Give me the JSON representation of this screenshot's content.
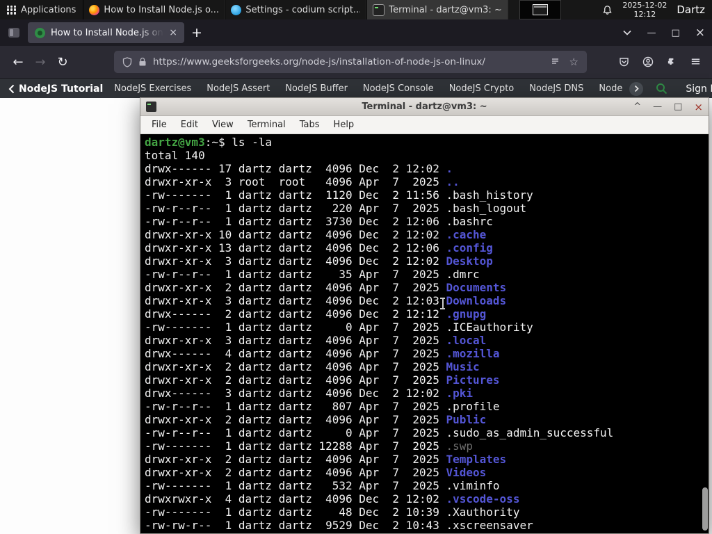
{
  "icons": {
    "back": "←",
    "forward": "→",
    "reload": "↻",
    "star": "☆",
    "close": "×",
    "minimize": "—",
    "maximize": "□",
    "new_tab": "+",
    "menu": "≡",
    "shade": "^"
  },
  "panel": {
    "applications": "Applications",
    "windows": [
      {
        "title": "How to Install Node.js o...",
        "icon": "firefox-window-icon",
        "active": false
      },
      {
        "title": "Settings - codium script...",
        "icon": "codium-window-icon",
        "active": false
      },
      {
        "title": "Terminal - dartz@vm3: ~",
        "icon": "terminal-window-icon",
        "active": true
      }
    ],
    "date": "2025-12-02",
    "time": "12:12",
    "user": "Dartz"
  },
  "browser": {
    "tab": {
      "title": "How to Install Node.js on"
    },
    "url": "https://www.geeksforgeeks.org/node-js/installation-of-node-js-on-linux/",
    "site_nav": {
      "back_label": "NodeJS Tutorial",
      "links": [
        "NodeJS Exercises",
        "NodeJS Assert",
        "NodeJS Buffer",
        "NodeJS Console",
        "NodeJS Crypto",
        "NodeJS DNS",
        "Node"
      ],
      "sign_in": "Sign In"
    }
  },
  "terminal": {
    "title": "Terminal - dartz@vm3: ~",
    "menu": [
      "File",
      "Edit",
      "View",
      "Terminal",
      "Tabs",
      "Help"
    ],
    "prompt": {
      "user_host": "dartz@vm3",
      "rest": ":~$ "
    },
    "command": "ls -la",
    "total": "total 140",
    "colors": {
      "prompt_green": "#44a544",
      "dir_blue": "#5456d6",
      "file_white": "#f2f2f2",
      "dim_gray": "#6e6e6e"
    },
    "listing": [
      {
        "perms": "drwx------",
        "links": 17,
        "owner": "dartz",
        "group": "dartz",
        "size": 4096,
        "month": "Dec",
        "day": 2,
        "time": "12:02",
        "name": ".",
        "kind": "dir"
      },
      {
        "perms": "drwxr-xr-x",
        "links": 3,
        "owner": "root",
        "group": "root",
        "size": 4096,
        "month": "Apr",
        "day": 7,
        "time": "2025",
        "name": "..",
        "kind": "dir"
      },
      {
        "perms": "-rw-------",
        "links": 1,
        "owner": "dartz",
        "group": "dartz",
        "size": 1120,
        "month": "Dec",
        "day": 2,
        "time": "11:56",
        "name": ".bash_history",
        "kind": "file"
      },
      {
        "perms": "-rw-r--r--",
        "links": 1,
        "owner": "dartz",
        "group": "dartz",
        "size": 220,
        "month": "Apr",
        "day": 7,
        "time": "2025",
        "name": ".bash_logout",
        "kind": "file"
      },
      {
        "perms": "-rw-r--r--",
        "links": 1,
        "owner": "dartz",
        "group": "dartz",
        "size": 3730,
        "month": "Dec",
        "day": 2,
        "time": "12:06",
        "name": ".bashrc",
        "kind": "file"
      },
      {
        "perms": "drwxr-xr-x",
        "links": 10,
        "owner": "dartz",
        "group": "dartz",
        "size": 4096,
        "month": "Dec",
        "day": 2,
        "time": "12:02",
        "name": ".cache",
        "kind": "dir"
      },
      {
        "perms": "drwxr-xr-x",
        "links": 13,
        "owner": "dartz",
        "group": "dartz",
        "size": 4096,
        "month": "Dec",
        "day": 2,
        "time": "12:06",
        "name": ".config",
        "kind": "dir"
      },
      {
        "perms": "drwxr-xr-x",
        "links": 3,
        "owner": "dartz",
        "group": "dartz",
        "size": 4096,
        "month": "Dec",
        "day": 2,
        "time": "12:02",
        "name": "Desktop",
        "kind": "dir"
      },
      {
        "perms": "-rw-r--r--",
        "links": 1,
        "owner": "dartz",
        "group": "dartz",
        "size": 35,
        "month": "Apr",
        "day": 7,
        "time": "2025",
        "name": ".dmrc",
        "kind": "file"
      },
      {
        "perms": "drwxr-xr-x",
        "links": 2,
        "owner": "dartz",
        "group": "dartz",
        "size": 4096,
        "month": "Apr",
        "day": 7,
        "time": "2025",
        "name": "Documents",
        "kind": "dir"
      },
      {
        "perms": "drwxr-xr-x",
        "links": 3,
        "owner": "dartz",
        "group": "dartz",
        "size": 4096,
        "month": "Dec",
        "day": 2,
        "time": "12:03",
        "name": "Downloads",
        "kind": "dir"
      },
      {
        "perms": "drwx------",
        "links": 2,
        "owner": "dartz",
        "group": "dartz",
        "size": 4096,
        "month": "Dec",
        "day": 2,
        "time": "12:12",
        "name": ".gnupg",
        "kind": "dir"
      },
      {
        "perms": "-rw-------",
        "links": 1,
        "owner": "dartz",
        "group": "dartz",
        "size": 0,
        "month": "Apr",
        "day": 7,
        "time": "2025",
        "name": ".ICEauthority",
        "kind": "file"
      },
      {
        "perms": "drwxr-xr-x",
        "links": 3,
        "owner": "dartz",
        "group": "dartz",
        "size": 4096,
        "month": "Apr",
        "day": 7,
        "time": "2025",
        "name": ".local",
        "kind": "dir"
      },
      {
        "perms": "drwx------",
        "links": 4,
        "owner": "dartz",
        "group": "dartz",
        "size": 4096,
        "month": "Apr",
        "day": 7,
        "time": "2025",
        "name": ".mozilla",
        "kind": "dir"
      },
      {
        "perms": "drwxr-xr-x",
        "links": 2,
        "owner": "dartz",
        "group": "dartz",
        "size": 4096,
        "month": "Apr",
        "day": 7,
        "time": "2025",
        "name": "Music",
        "kind": "dir"
      },
      {
        "perms": "drwxr-xr-x",
        "links": 2,
        "owner": "dartz",
        "group": "dartz",
        "size": 4096,
        "month": "Apr",
        "day": 7,
        "time": "2025",
        "name": "Pictures",
        "kind": "dir"
      },
      {
        "perms": "drwx------",
        "links": 3,
        "owner": "dartz",
        "group": "dartz",
        "size": 4096,
        "month": "Dec",
        "day": 2,
        "time": "12:02",
        "name": ".pki",
        "kind": "dir"
      },
      {
        "perms": "-rw-r--r--",
        "links": 1,
        "owner": "dartz",
        "group": "dartz",
        "size": 807,
        "month": "Apr",
        "day": 7,
        "time": "2025",
        "name": ".profile",
        "kind": "file"
      },
      {
        "perms": "drwxr-xr-x",
        "links": 2,
        "owner": "dartz",
        "group": "dartz",
        "size": 4096,
        "month": "Apr",
        "day": 7,
        "time": "2025",
        "name": "Public",
        "kind": "dir"
      },
      {
        "perms": "-rw-r--r--",
        "links": 1,
        "owner": "dartz",
        "group": "dartz",
        "size": 0,
        "month": "Apr",
        "day": 7,
        "time": "2025",
        "name": ".sudo_as_admin_successful",
        "kind": "file"
      },
      {
        "perms": "-rw-------",
        "links": 1,
        "owner": "dartz",
        "group": "dartz",
        "size": 12288,
        "month": "Apr",
        "day": 7,
        "time": "2025",
        "name": ".swp",
        "kind": "dim"
      },
      {
        "perms": "drwxr-xr-x",
        "links": 2,
        "owner": "dartz",
        "group": "dartz",
        "size": 4096,
        "month": "Apr",
        "day": 7,
        "time": "2025",
        "name": "Templates",
        "kind": "dir"
      },
      {
        "perms": "drwxr-xr-x",
        "links": 2,
        "owner": "dartz",
        "group": "dartz",
        "size": 4096,
        "month": "Apr",
        "day": 7,
        "time": "2025",
        "name": "Videos",
        "kind": "dir"
      },
      {
        "perms": "-rw-------",
        "links": 1,
        "owner": "dartz",
        "group": "dartz",
        "size": 532,
        "month": "Apr",
        "day": 7,
        "time": "2025",
        "name": ".viminfo",
        "kind": "file"
      },
      {
        "perms": "drwxrwxr-x",
        "links": 4,
        "owner": "dartz",
        "group": "dartz",
        "size": 4096,
        "month": "Dec",
        "day": 2,
        "time": "12:02",
        "name": ".vscode-oss",
        "kind": "dir"
      },
      {
        "perms": "-rw-------",
        "links": 1,
        "owner": "dartz",
        "group": "dartz",
        "size": 48,
        "month": "Dec",
        "day": 2,
        "time": "10:39",
        "name": ".Xauthority",
        "kind": "file"
      },
      {
        "perms": "-rw-rw-r--",
        "links": 1,
        "owner": "dartz",
        "group": "dartz",
        "size": 9529,
        "month": "Dec",
        "day": 2,
        "time": "10:43",
        "name": ".xscreensaver",
        "kind": "file"
      }
    ]
  }
}
